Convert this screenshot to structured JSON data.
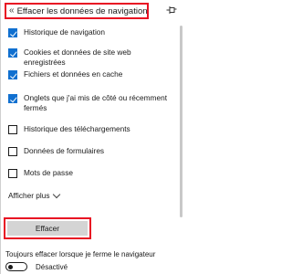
{
  "header": {
    "back_glyph": "«",
    "title": "Effacer les données de navigation",
    "pin_icon": "pin-icon"
  },
  "options": [
    {
      "label": "Historique de navigation",
      "checked": true
    },
    {
      "label": "Cookies et données de site web enregistrées",
      "checked": true
    },
    {
      "label": "Fichiers et données en cache",
      "checked": true
    },
    {
      "label": "Onglets que j'ai mis de côté ou récemment fermés",
      "checked": true
    },
    {
      "label": "Historique des téléchargements",
      "checked": false
    },
    {
      "label": "Données de formulaires",
      "checked": false
    },
    {
      "label": "Mots de passe",
      "checked": false
    }
  ],
  "show_more": "Afficher plus",
  "clear_button": "Effacer",
  "always_clear": "Toujours effacer lorsque je ferme le navigateur",
  "toggle": {
    "label": "Désactivé",
    "on": false
  },
  "colors": {
    "accent": "#1070d0",
    "highlight": "#e81123",
    "button_bg": "#d4d4d4"
  }
}
